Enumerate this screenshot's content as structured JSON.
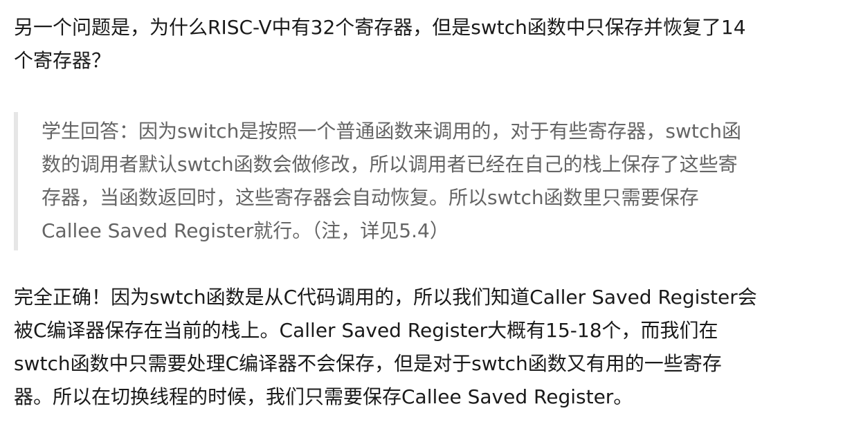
{
  "paragraph_1": {
    "line_1": "另一个问题是，为什么RISC-V中有32个寄存器，但是swtch函数中只保存并恢复了14",
    "line_2": "个寄存器？"
  },
  "quote": {
    "line_1": "学生回答：因为switch是按照一个普通函数来调用的，对于有些寄存器，swtch函",
    "line_2": "数的调用者默认swtch函数会做修改，所以调用者已经在自己的栈上保存了这些寄",
    "line_3": "存器，当函数返回时，这些寄存器会自动恢复。所以swtch函数里只需要保存",
    "line_4": "Callee Saved Register就行。（注，详见5.4）"
  },
  "paragraph_3": {
    "line_1": "完全正确！因为swtch函数是从C代码调用的，所以我们知道Caller Saved Register会",
    "line_2": "被C编译器保存在当前的栈上。Caller Saved Register大概有15-18个，而我们在",
    "line_3": "swtch函数中只需要处理C编译器不会保存，但是对于swtch函数又有用的一些寄存",
    "line_4": "器。所以在切换线程的时候，我们只需要保存Callee Saved Register。"
  }
}
